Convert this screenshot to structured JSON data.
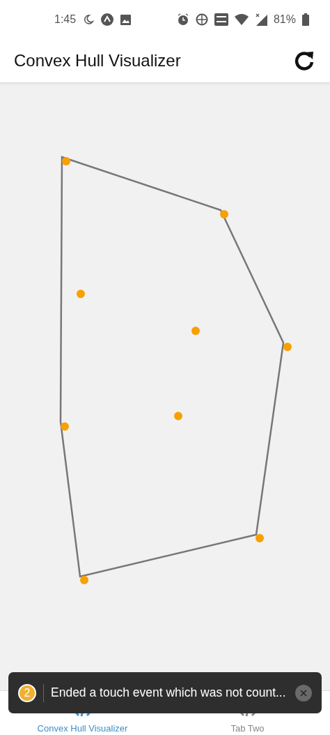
{
  "status_bar": {
    "time": "1:45",
    "battery": "81%"
  },
  "app_bar": {
    "title": "Convex Hull Visualizer"
  },
  "tabs": [
    {
      "label": "Convex Hull Visualizer",
      "selected": true
    },
    {
      "label": "Tab Two",
      "selected": false
    }
  ],
  "toast": {
    "count": "2",
    "message": "Ended a touch event which was not count..."
  }
}
